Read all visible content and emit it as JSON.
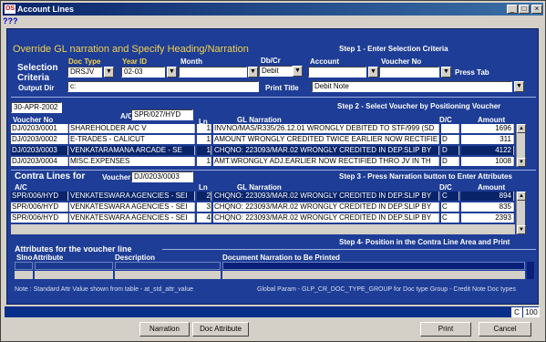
{
  "window": {
    "title": "Account Lines",
    "app_icon": "app-logo-icon"
  },
  "menu": {
    "help_label": "???"
  },
  "header": {
    "main_title": "Override GL narration and Specify Heading/Narration",
    "step1": "Step 1 - Enter Selection Criteria"
  },
  "criteria": {
    "label_selection": "Selection",
    "label_criteria": "Criteria",
    "doc_type_label": "Doc Type",
    "doc_type_value": "DRSJV",
    "year_id_label": "Year ID",
    "year_id_value": "02-03",
    "month_label": "Month",
    "month_value": "",
    "dbcr_label": "Db/Cr",
    "dbcr_value": "Debit",
    "account_label": "Account",
    "account_value": "",
    "voucher_no_label": "Voucher No",
    "voucher_no_value": "",
    "press_tab": "Press Tab",
    "output_dir_label": "Output Dir",
    "output_dir_value": "c:",
    "print_title_label": "Print Title",
    "print_title_value": "Debit Note"
  },
  "voucher_section": {
    "date": "30-APR-2002",
    "ac_label": "A/C",
    "ac_value": "SPR/027/HYD",
    "step2": "Step 2 - Select Voucher by Positioning Voucher",
    "columns": [
      "Voucher No",
      "Ln",
      "GL Narration",
      "D/C",
      "Amount"
    ],
    "rows": [
      {
        "voucher": "DJ/0203/0001",
        "account": "SHAREHOLDER A/C V",
        "ln": "1",
        "narration": "INVNO/MAS/R335/26.12.01 WRONGLY DEBITED TO STF/999 (SD",
        "dc": "",
        "amount": "1696"
      },
      {
        "voucher": "DJ/0203/0002",
        "account": "E-TRADES - CALICUT",
        "ln": "1",
        "narration": "AMOUNT WRONGLY CREDITED TWICE EARLIER NOW RECTIFIE",
        "dc": "D",
        "amount": "311"
      },
      {
        "voucher": "DJ/0203/0003",
        "account": "VENKATARAMANA ARCADE - SE",
        "ln": "1",
        "narration": "CHQNO: 223093/MAR.02 WRONGLY CREDITED IN DEP.SLIP BY",
        "dc": "D",
        "amount": "4122"
      },
      {
        "voucher": "DJ/0203/0004",
        "account": "MISC.EXPENSES",
        "ln": "1",
        "narration": "AMT.WRONGLY ADJ.EARLIER NOW RECTIFIED THRO JV IN TH",
        "dc": "D",
        "amount": "1008"
      }
    ]
  },
  "contra_section": {
    "title": "Contra Lines for",
    "voucher_label": "Voucher",
    "voucher_value": "DJ/0203/0003",
    "step3": "Step 3 - Press Narration button to Enter Attributes",
    "columns": [
      "A/C",
      "Ln",
      "GL Narration",
      "D/C",
      "Amount"
    ],
    "rows": [
      {
        "ac": "SPR/006/HYD",
        "account": "VENKATESWARA AGENCIES - SEI",
        "ln": "2",
        "narration": "CHQNO: 223093/MAR.02 WRONGLY CREDITED IN DEP.SLIP BY",
        "dc": "C",
        "amount": "894"
      },
      {
        "ac": "SPR/006/HYD",
        "account": "VENKATESWARA AGENCIES - SEI",
        "ln": "3",
        "narration": "CHQNO: 223093/MAR.02 WRONGLY CREDITED IN DEP.SLIP BY",
        "dc": "C",
        "amount": "835"
      },
      {
        "ac": "SPR/006/HYD",
        "account": "VENKATESWARA AGENCIES - SEI",
        "ln": "4",
        "narration": "CHQNO: 223093/MAR.02 WRONGLY CREDITED IN DEP.SLIP BY",
        "dc": "C",
        "amount": "2393"
      }
    ],
    "step4": "Step 4- Position in the Contra Line Area and Print"
  },
  "attributes": {
    "title": "Attributes for the voucher line",
    "columns": [
      "Slno",
      "Attribute",
      "Description",
      "Document Narration to Be Printed"
    ],
    "note_left": "Note : Standard Attr Value shown from table - at_std_attr_value",
    "note_right": "Global Param - GLP_CR_DOC_TYPE_GROUP for Doc type Group - Credit Note Doc types"
  },
  "status": {
    "mode": "C",
    "value": "100"
  },
  "buttons": {
    "narration": "Narration",
    "doc_attribute": "Doc Attribute",
    "print": "Print",
    "cancel": "Cancel"
  }
}
